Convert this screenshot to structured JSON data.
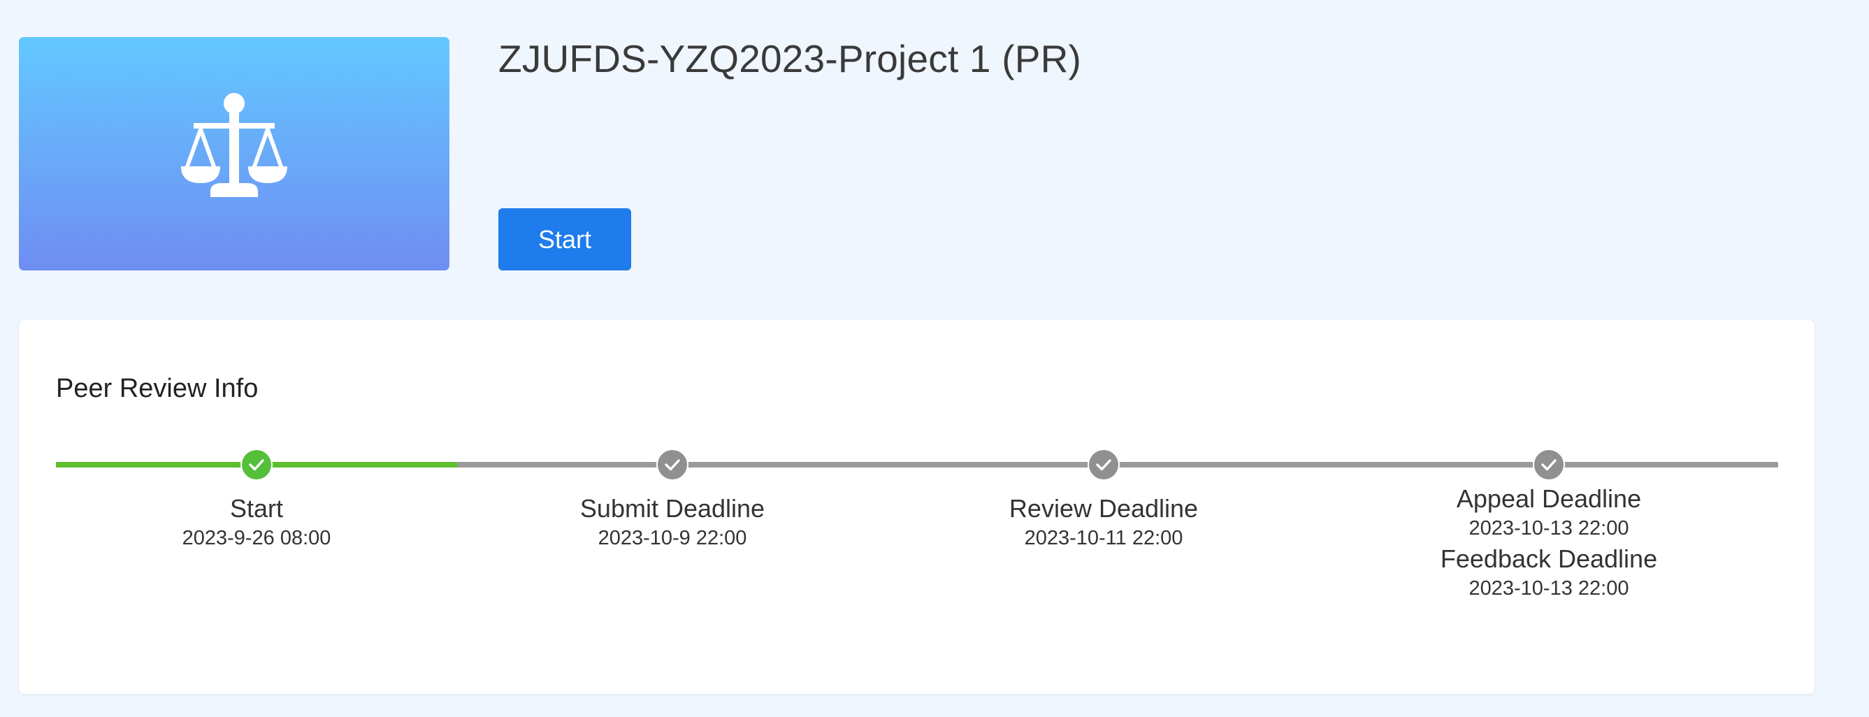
{
  "header": {
    "cover_icon": "scales-icon",
    "title": "ZJUFDS-YZQ2023-Project 1 (PR)",
    "start_button_label": "Start",
    "primary_color": "#1e7cec"
  },
  "peer_review": {
    "heading": "Peer Review Info",
    "progress_color": "#5cbf2e",
    "pending_color": "#9a9a9a",
    "milestones": [
      {
        "label": "Start",
        "date": "2023-9-26 08:00",
        "status": "done"
      },
      {
        "label": "Submit Deadline",
        "date": "2023-10-9 22:00",
        "status": "pending"
      },
      {
        "label": "Review Deadline",
        "date": "2023-10-11 22:00",
        "status": "pending"
      },
      {
        "label": "Appeal Deadline",
        "date": "2023-10-13 22:00",
        "extra_label": "Feedback Deadline",
        "extra_date": "2023-10-13 22:00",
        "status": "pending"
      }
    ]
  }
}
